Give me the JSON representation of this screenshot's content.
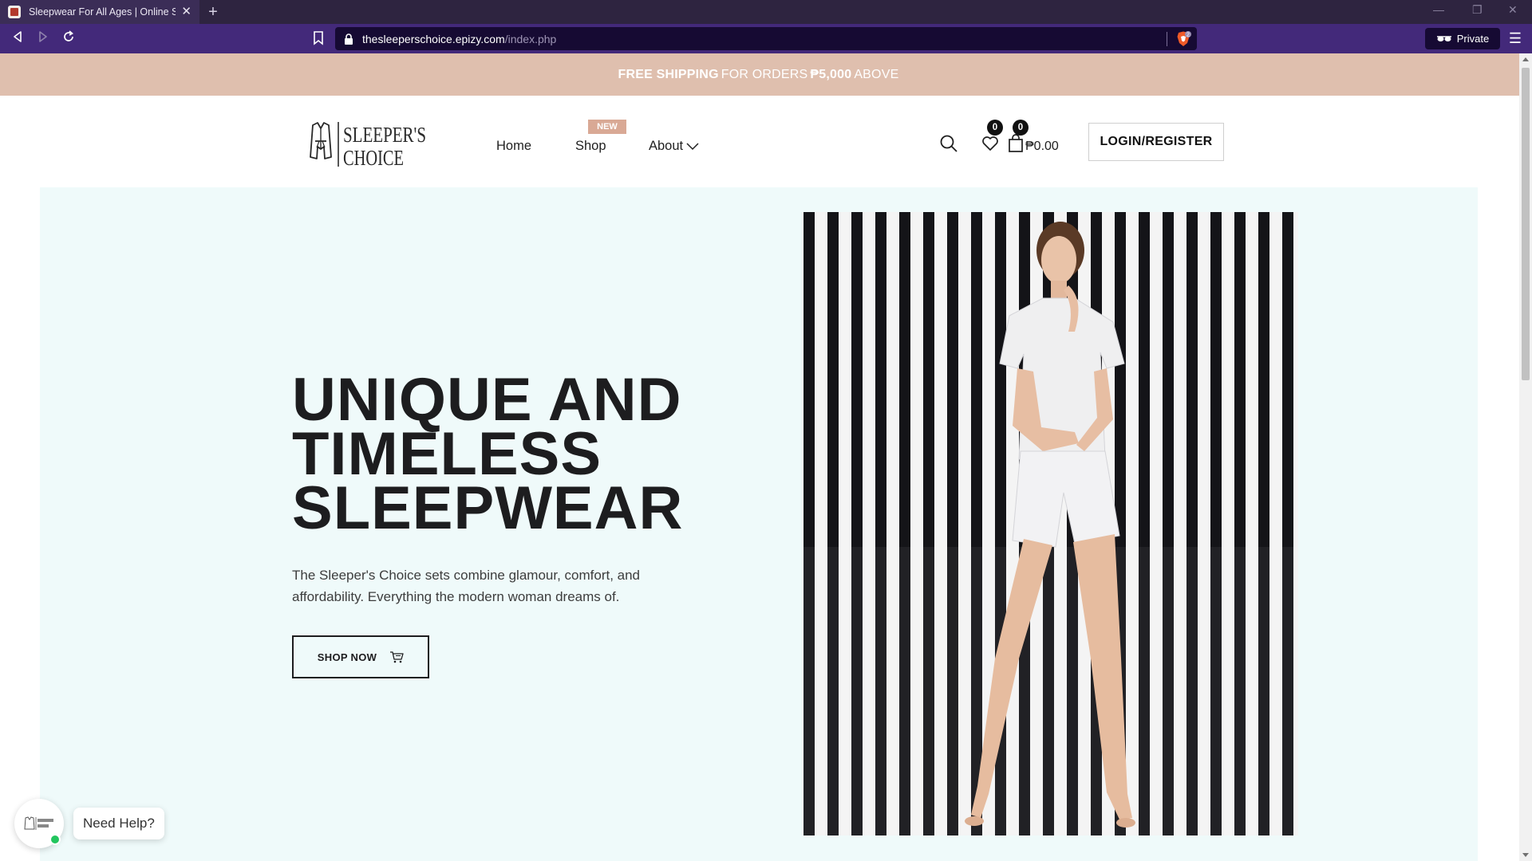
{
  "browser": {
    "tab_title": "Sleepwear For All Ages | Online Sleepwear",
    "new_tab": "+",
    "url_host": "thesleeperschoice.epizy.com",
    "url_path": "/index.php",
    "private_label": "Private",
    "shield_count": "2"
  },
  "promo": {
    "free_shipping": "FREE SHIPPING",
    "for_orders": "FOR ORDERS",
    "amount": "₱5,000",
    "above": "ABOVE"
  },
  "header": {
    "logo_line1": "SLEEPER'S",
    "logo_line2": "CHOICE",
    "nav": {
      "home": "Home",
      "shop": "Shop",
      "shop_badge": "NEW",
      "about": "About"
    },
    "wishlist_count": "0",
    "cart_count": "0",
    "cart_total": "₱0.00",
    "login_label": "LOGIN/REGISTER"
  },
  "hero": {
    "title_lines": [
      "UNIQUE AND",
      "TIMELESS",
      "SLEEPWEAR"
    ],
    "description": "The Sleeper's Choice sets combine glamour, comfort, and affordability. Everything the modern woman dreams of.",
    "cta_label": "SHOP NOW"
  },
  "help_widget": {
    "label": "Need Help?"
  },
  "colors": {
    "promo_bg": "#dfbfae",
    "hero_bg": "#effafa",
    "badge_bg": "#d9a995",
    "online_dot": "#22c55e",
    "browser_bar": "#43297a"
  }
}
